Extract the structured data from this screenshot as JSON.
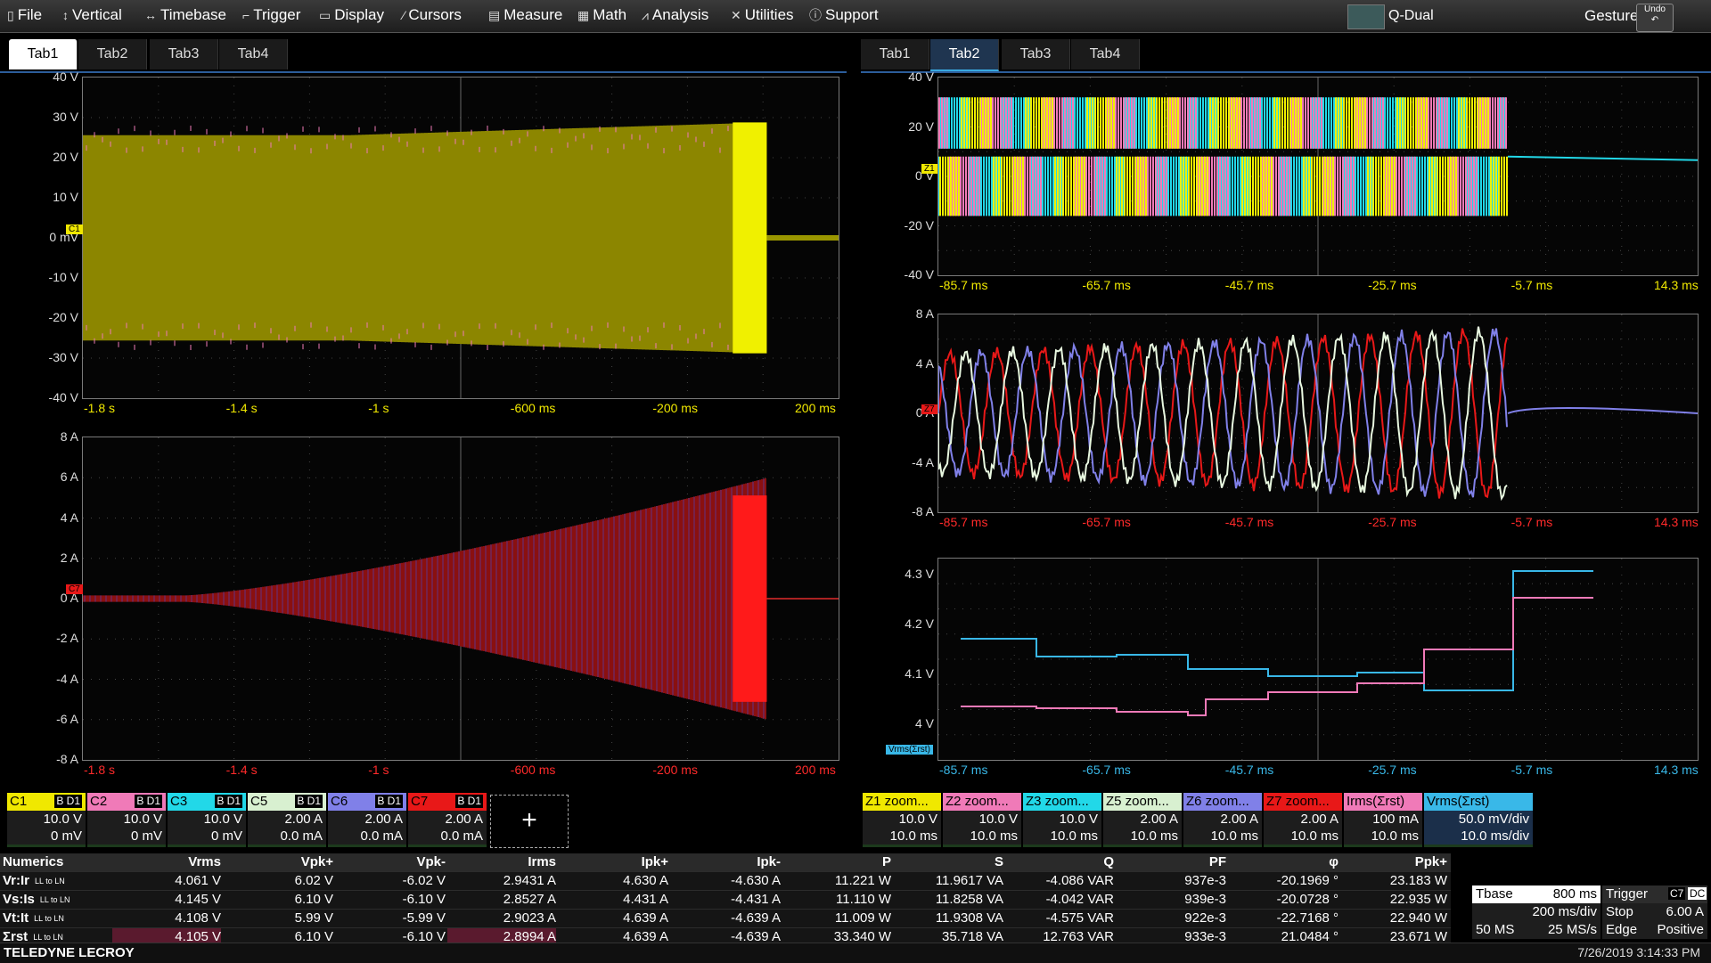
{
  "menu": [
    {
      "label": "File",
      "icon": "file-icon"
    },
    {
      "label": "Vertical",
      "icon": "vertical-arrows-icon"
    },
    {
      "label": "Timebase",
      "icon": "horizontal-arrows-icon"
    },
    {
      "label": "Trigger",
      "icon": "trigger-icon"
    },
    {
      "label": "Display",
      "icon": "display-icon"
    },
    {
      "label": "Cursors",
      "icon": "cursors-icon"
    },
    {
      "label": "Measure",
      "icon": "measure-icon"
    },
    {
      "label": "Math",
      "icon": "math-icon"
    },
    {
      "label": "Analysis",
      "icon": "analysis-icon"
    },
    {
      "label": "Utilities",
      "icon": "utilities-icon"
    },
    {
      "label": "Support",
      "icon": "info-icon"
    }
  ],
  "display_mode": "Q-Dual",
  "gesture_label": "Gesture",
  "undo_label": "Undo",
  "tabs_left": [
    "Tab1",
    "Tab2",
    "Tab3",
    "Tab4"
  ],
  "tabs_right": [
    "Tab1",
    "Tab2",
    "Tab3",
    "Tab4"
  ],
  "active_left_tab": "Tab1",
  "active_right_tab": "Tab2",
  "grids": {
    "g1": {
      "y": [
        "40 V",
        "30 V",
        "20 V",
        "10 V",
        "0 mV",
        "-10 V",
        "-20 V",
        "-30 V",
        "-40 V"
      ],
      "x": [
        "-1.8 s",
        "-1.4 s",
        "-1 s",
        "-600 ms",
        "-200 ms",
        "200 ms"
      ],
      "xcolor": "#f0e800",
      "marker": "C1"
    },
    "g2": {
      "y": [
        "8 A",
        "6 A",
        "4 A",
        "2 A",
        "0 A",
        "-2 A",
        "-4 A",
        "-6 A",
        "-8 A"
      ],
      "x": [
        "-1.8 s",
        "-1.4 s",
        "-1 s",
        "-600 ms",
        "-200 ms",
        "200 ms"
      ],
      "xcolor": "#ff2a2a",
      "marker": "C7"
    },
    "g3": {
      "y": [
        "40 V",
        "20 V",
        "0 V",
        "-20 V",
        "-40 V"
      ],
      "x": [
        "-85.7 ms",
        "-65.7 ms",
        "-45.7 ms",
        "-25.7 ms",
        "-5.7 ms",
        "14.3 ms"
      ],
      "xcolor": "#f0e800",
      "marker": "Z1"
    },
    "g4": {
      "y": [
        "8 A",
        "4 A",
        "0 A",
        "-4 A",
        "-8 A"
      ],
      "x": [
        "-85.7 ms",
        "-65.7 ms",
        "-45.7 ms",
        "-25.7 ms",
        "-5.7 ms",
        "14.3 ms"
      ],
      "xcolor": "#ff2a2a",
      "marker": "Z7"
    },
    "g5": {
      "y": [
        "4.3 V",
        "4.2 V",
        "4.1 V",
        "4 V"
      ],
      "x": [
        "-85.7 ms",
        "-65.7 ms",
        "-45.7 ms",
        "-25.7 ms",
        "-5.7 ms",
        "14.3 ms"
      ],
      "xcolor": "#39b8e8",
      "marker": "Vrms(Σrst)"
    }
  },
  "channels_left": [
    {
      "name": "C1",
      "tag": "B D1",
      "color": "#f0e800",
      "v1": "10.0 V",
      "v2": "0 mV"
    },
    {
      "name": "C2",
      "tag": "B D1",
      "color": "#f07ab8",
      "v1": "10.0 V",
      "v2": "0 mV"
    },
    {
      "name": "C3",
      "tag": "B D1",
      "color": "#22d8e8",
      "v1": "10.0 V",
      "v2": "0 mV"
    },
    {
      "name": "C5",
      "tag": "B D1",
      "color": "#d8f0d0",
      "v1": "2.00 A",
      "v2": "0.0 mA"
    },
    {
      "name": "C6",
      "tag": "B D1",
      "color": "#8080e8",
      "v1": "2.00 A",
      "v2": "0.0 mA"
    },
    {
      "name": "C7",
      "tag": "B D1",
      "color": "#e81818",
      "v1": "2.00 A",
      "v2": "0.0 mA"
    }
  ],
  "add_label": "+",
  "channels_right": [
    {
      "name": "Z1 zoom...",
      "color": "#f0e800",
      "v1": "10.0 V",
      "v2": "10.0 ms"
    },
    {
      "name": "Z2 zoom...",
      "color": "#f07ab8",
      "v1": "10.0 V",
      "v2": "10.0 ms"
    },
    {
      "name": "Z3 zoom...",
      "color": "#22d8e8",
      "v1": "10.0 V",
      "v2": "10.0 ms"
    },
    {
      "name": "Z5 zoom...",
      "color": "#d8f0d0",
      "v1": "2.00 A",
      "v2": "10.0 ms"
    },
    {
      "name": "Z6 zoom...",
      "color": "#8080e8",
      "v1": "2.00 A",
      "v2": "10.0 ms"
    },
    {
      "name": "Z7 zoom...",
      "color": "#e81818",
      "v1": "2.00 A",
      "v2": "10.0 ms"
    },
    {
      "name": "Irms(Σrst)",
      "color": "#f07ab8",
      "v1": "100 mA",
      "v2": "10.0 ms"
    },
    {
      "name": "Vrms(Σrst)",
      "color": "#39b8e8",
      "v1": "50.0 mV/div",
      "v2": "10.0 ms/div"
    }
  ],
  "numerics": {
    "title": "Numerics",
    "headers": [
      "Vrms",
      "Vpk+",
      "Vpk-",
      "Irms",
      "Ipk+",
      "Ipk-",
      "P",
      "S",
      "Q",
      "PF",
      "φ",
      "Ppk+"
    ],
    "rows": [
      {
        "name": "Vr:Ir",
        "sub": "LL to LN",
        "values": [
          "4.061 V",
          "6.02 V",
          "-6.02 V",
          "2.9431 A",
          "4.630 A",
          "-4.630 A",
          "11.221 W",
          "11.9617 VA",
          "-4.086 VAR",
          "937e-3",
          "-20.1969 °",
          "23.183 W"
        ]
      },
      {
        "name": "Vs:Is",
        "sub": "LL to LN",
        "values": [
          "4.145 V",
          "6.10 V",
          "-6.10 V",
          "2.8527 A",
          "4.431 A",
          "-4.431 A",
          "11.110 W",
          "11.8258 VA",
          "-4.042 VAR",
          "939e-3",
          "-20.0728 °",
          "22.935 W"
        ]
      },
      {
        "name": "Vt:It",
        "sub": "LL to LN",
        "values": [
          "4.108 V",
          "5.99 V",
          "-5.99 V",
          "2.9023 A",
          "4.639 A",
          "-4.639 A",
          "11.009 W",
          "11.9308 VA",
          "-4.575 VAR",
          "922e-3",
          "-22.7168 °",
          "22.940 W"
        ]
      },
      {
        "name": "Σrst",
        "sub": "LL to LN",
        "values": [
          "4.105 V",
          "6.10 V",
          "-6.10 V",
          "2.8994 A",
          "4.639 A",
          "-4.639 A",
          "33.340 W",
          "35.718 VA",
          "12.763 VAR",
          "933e-3",
          "21.0484 °",
          "23.671 W"
        ]
      }
    ]
  },
  "timebase": {
    "label": "Tbase",
    "value": "800 ms",
    "div": "200 ms/div",
    "samples": "50 MS",
    "rate": "25 MS/s"
  },
  "trigger": {
    "label": "Trigger",
    "chan": "C7",
    "coupling": "DC",
    "mode": "Stop",
    "level": "6.00 A",
    "type": "Edge",
    "slope": "Positive"
  },
  "footer": {
    "brand": "TELEDYNE LECROY",
    "datetime": "7/26/2019 3:14:33 PM"
  }
}
